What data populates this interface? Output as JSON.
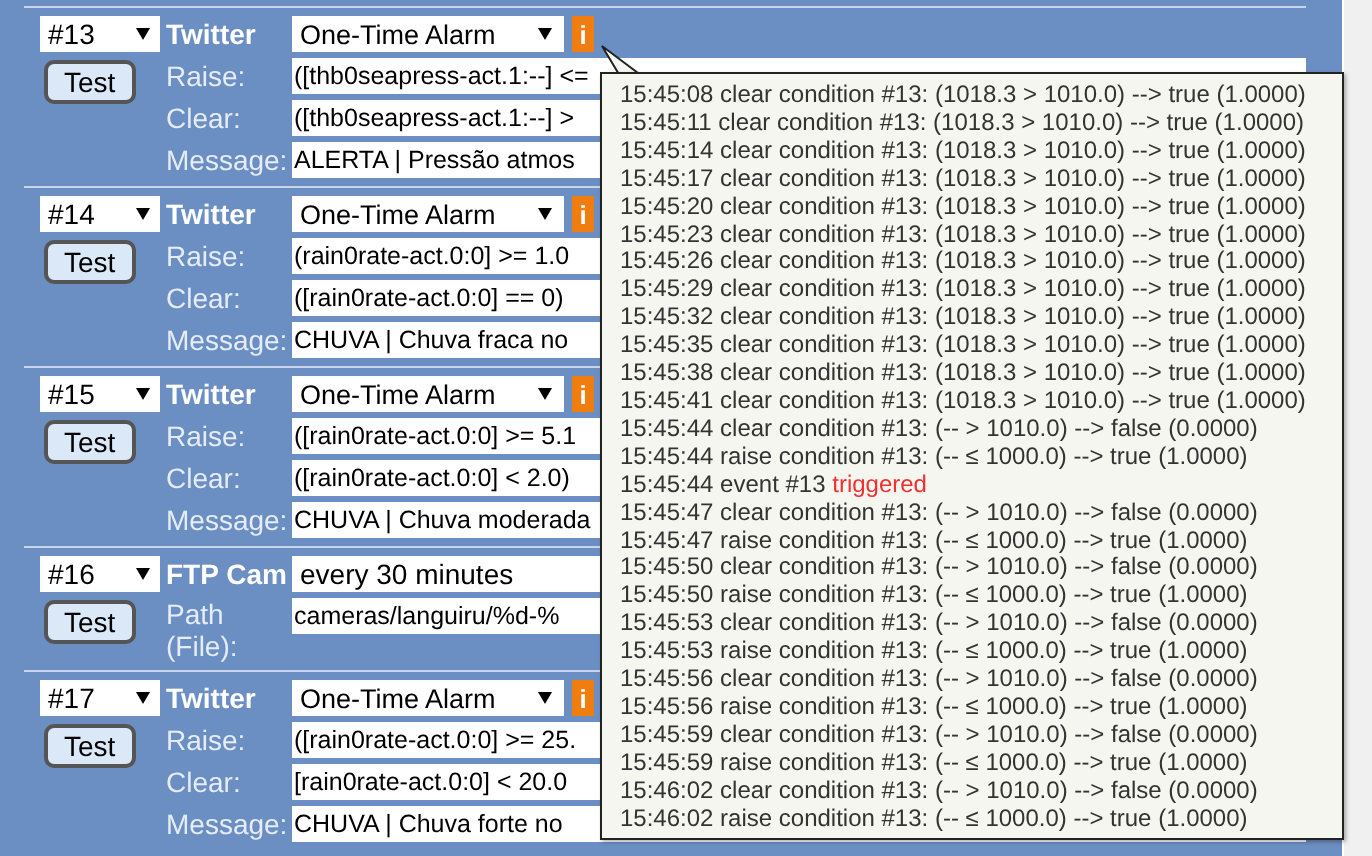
{
  "rules": [
    {
      "number": "#13",
      "type": "Twitter",
      "schedule": {
        "kind": "dropdown",
        "value": "One-Time Alarm"
      },
      "info": "i",
      "test": "Test",
      "fields": [
        {
          "label": "Raise:",
          "value": "([thb0seapress-act.1:--] <="
        },
        {
          "label": "Clear:",
          "value": "([thb0seapress-act.1:--] >"
        },
        {
          "label": "Message:",
          "value": "ALERTA | Pressão atmos"
        }
      ]
    },
    {
      "number": "#14",
      "type": "Twitter",
      "schedule": {
        "kind": "dropdown",
        "value": "One-Time Alarm"
      },
      "info": "i",
      "test": "Test",
      "fields": [
        {
          "label": "Raise:",
          "value": "(rain0rate-act.0:0] >= 1.0"
        },
        {
          "label": "Clear:",
          "value": "([rain0rate-act.0:0] == 0)"
        },
        {
          "label": "Message:",
          "value": "CHUVA | Chuva fraca no"
        }
      ]
    },
    {
      "number": "#15",
      "type": "Twitter",
      "schedule": {
        "kind": "dropdown",
        "value": "One-Time Alarm"
      },
      "info": "i",
      "test": "Test",
      "fields": [
        {
          "label": "Raise:",
          "value": "([rain0rate-act.0:0] >= 5.1"
        },
        {
          "label": "Clear:",
          "value": "([rain0rate-act.0:0] < 2.0)"
        },
        {
          "label": "Message:",
          "value": "CHUVA | Chuva moderada"
        }
      ]
    },
    {
      "number": "#16",
      "type": "FTP Cam",
      "schedule": {
        "kind": "text",
        "value": "every 30 minutes"
      },
      "test": "Test",
      "fields": [
        {
          "label": "Path (File):",
          "value": "cameras/languiru/%d-%"
        }
      ]
    },
    {
      "number": "#17",
      "type": "Twitter",
      "schedule": {
        "kind": "dropdown",
        "value": "One-Time Alarm"
      },
      "info": "i",
      "test": "Test",
      "fields": [
        {
          "label": "Raise:",
          "value": "([rain0rate-act.0:0] >= 25."
        },
        {
          "label": "Clear:",
          "value": "[rain0rate-act.0:0] < 20.0"
        },
        {
          "label": "Message:",
          "value": "CHUVA | Chuva forte no"
        }
      ]
    }
  ],
  "log": [
    {
      "kind": "condition",
      "text": "15:45:08 clear condition #13: (1018.3 > 1010.0) --> true (1.0000)"
    },
    {
      "kind": "condition",
      "text": "15:45:11 clear condition #13: (1018.3 > 1010.0) --> true (1.0000)"
    },
    {
      "kind": "condition",
      "text": "15:45:14 clear condition #13: (1018.3 > 1010.0) --> true (1.0000)"
    },
    {
      "kind": "condition",
      "text": "15:45:17 clear condition #13: (1018.3 > 1010.0) --> true (1.0000)"
    },
    {
      "kind": "condition",
      "text": "15:45:20 clear condition #13: (1018.3 > 1010.0) --> true (1.0000)"
    },
    {
      "kind": "condition",
      "text": "15:45:23 clear condition #13: (1018.3 > 1010.0) --> true (1.0000)"
    },
    {
      "kind": "condition",
      "text": "15:45:26 clear condition #13: (1018.3 > 1010.0) --> true (1.0000)"
    },
    {
      "kind": "condition",
      "text": "15:45:29 clear condition #13: (1018.3 > 1010.0) --> true (1.0000)"
    },
    {
      "kind": "condition",
      "text": "15:45:32 clear condition #13: (1018.3 > 1010.0) --> true (1.0000)"
    },
    {
      "kind": "condition",
      "text": "15:45:35 clear condition #13: (1018.3 > 1010.0) --> true (1.0000)"
    },
    {
      "kind": "condition",
      "text": "15:45:38 clear condition #13: (1018.3 > 1010.0) --> true (1.0000)"
    },
    {
      "kind": "condition",
      "text": "15:45:41 clear condition #13: (1018.3 > 1010.0) --> true (1.0000)"
    },
    {
      "kind": "condition",
      "text": "15:45:44 clear condition #13: (-- > 1010.0) --> false (0.0000)"
    },
    {
      "kind": "condition",
      "text": "15:45:44 raise condition #13: (-- ≤ 1000.0) --> true (1.0000)"
    },
    {
      "kind": "event",
      "text": "15:45:44 event #13",
      "status": "triggered"
    },
    {
      "kind": "condition",
      "text": "15:45:47 clear condition #13: (-- > 1010.0) --> false (0.0000)"
    },
    {
      "kind": "condition",
      "text": "15:45:47 raise condition #13: (-- ≤ 1000.0) --> true (1.0000)"
    },
    {
      "kind": "condition",
      "text": "15:45:50 clear condition #13: (-- > 1010.0) --> false (0.0000)"
    },
    {
      "kind": "condition",
      "text": "15:45:50 raise condition #13: (-- ≤ 1000.0) --> true (1.0000)"
    },
    {
      "kind": "condition",
      "text": "15:45:53 clear condition #13: (-- > 1010.0) --> false (0.0000)"
    },
    {
      "kind": "condition",
      "text": "15:45:53 raise condition #13: (-- ≤ 1000.0) --> true (1.0000)"
    },
    {
      "kind": "condition",
      "text": "15:45:56 clear condition #13: (-- > 1010.0) --> false (0.0000)"
    },
    {
      "kind": "condition",
      "text": "15:45:56 raise condition #13: (-- ≤ 1000.0) --> true (1.0000)"
    },
    {
      "kind": "condition",
      "text": "15:45:59 clear condition #13: (-- > 1010.0) --> false (0.0000)"
    },
    {
      "kind": "condition",
      "text": "15:45:59 raise condition #13: (-- ≤ 1000.0) --> true (1.0000)"
    },
    {
      "kind": "condition",
      "text": "15:46:02 clear condition #13: (-- > 1010.0) --> false (0.0000)"
    },
    {
      "kind": "condition",
      "text": "15:46:02 raise condition #13: (-- ≤ 1000.0) --> true (1.0000)"
    }
  ]
}
